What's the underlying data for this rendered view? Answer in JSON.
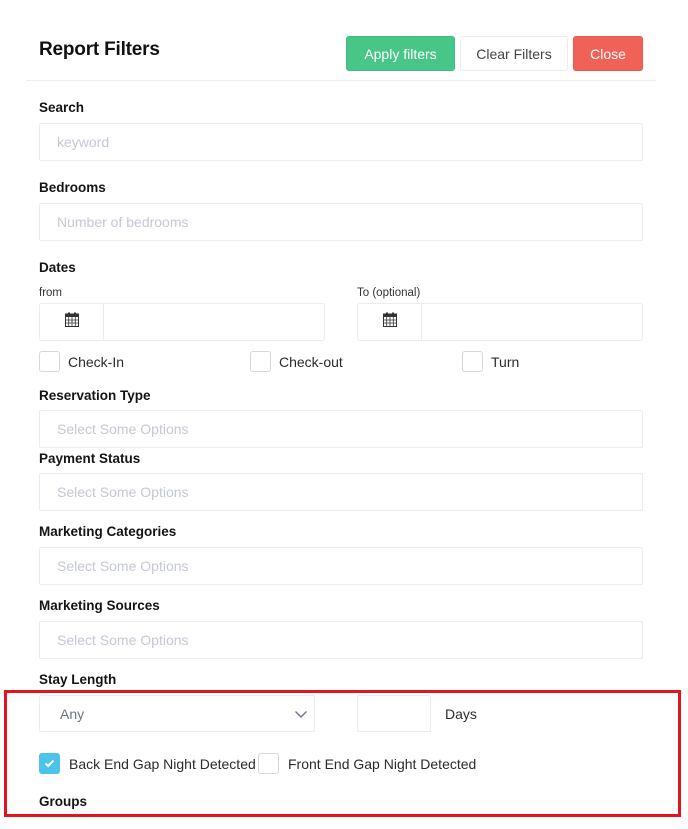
{
  "header": {
    "title": "Report Filters",
    "apply_label": "Apply filters",
    "clear_label": "Clear Filters",
    "close_label": "Close"
  },
  "colors": {
    "apply": "#47c687",
    "close": "#f06157",
    "checkbox_checked": "#4bc3ea",
    "highlight_box": "#e3141e"
  },
  "search": {
    "label": "Search",
    "placeholder": "keyword",
    "value": ""
  },
  "bedrooms": {
    "label": "Bedrooms",
    "placeholder": "Number of bedrooms",
    "value": ""
  },
  "dates": {
    "label": "Dates",
    "from_label": "from",
    "to_label": "To (optional)",
    "from_value": "",
    "to_value": "",
    "icon": "calendar-icon",
    "options": [
      {
        "label": "Check-In",
        "checked": false
      },
      {
        "label": "Check-out",
        "checked": false
      },
      {
        "label": "Turn",
        "checked": false
      }
    ]
  },
  "reservation_type": {
    "label": "Reservation Type",
    "placeholder": "Select Some Options"
  },
  "payment_status": {
    "label": "Payment Status",
    "placeholder": "Select Some Options"
  },
  "marketing_categories": {
    "label": "Marketing Categories",
    "placeholder": "Select Some Options"
  },
  "marketing_sources": {
    "label": "Marketing Sources",
    "placeholder": "Select Some Options"
  },
  "stay_length": {
    "label": "Stay Length",
    "selected": "Any",
    "days_value": "",
    "days_label": "Days"
  },
  "gap_nights": [
    {
      "label": "Back End Gap Night Detected",
      "checked": true
    },
    {
      "label": "Front End Gap Night Detected",
      "checked": false
    }
  ],
  "groups": {
    "label": "Groups"
  }
}
